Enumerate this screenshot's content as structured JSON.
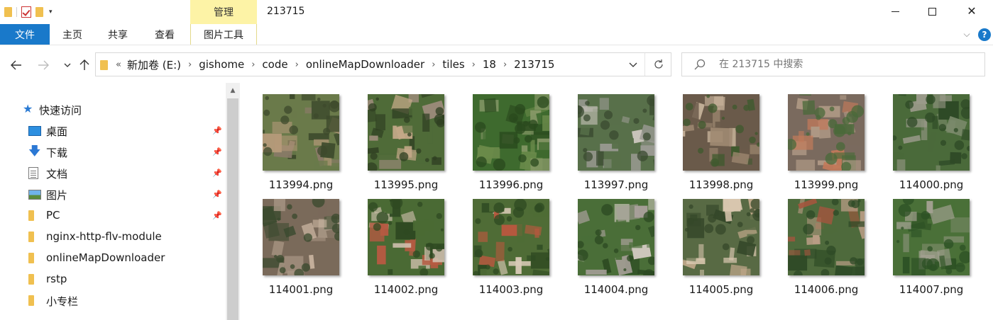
{
  "titlebar": {
    "manage_tab": "管理",
    "window_title": "213715",
    "minimize": "—",
    "maximize": "□",
    "close": "✕"
  },
  "ribbon": {
    "tabs": [
      {
        "label": "文件"
      },
      {
        "label": "主页"
      },
      {
        "label": "共享"
      },
      {
        "label": "查看"
      },
      {
        "label": "图片工具"
      }
    ],
    "help": "?"
  },
  "address": {
    "overflow": "«",
    "crumbs": [
      "新加卷 (E:)",
      "gishome",
      "code",
      "onlineMapDownloader",
      "tiles",
      "18",
      "213715"
    ],
    "separator": "›"
  },
  "search": {
    "placeholder": "在 213715 中搜索"
  },
  "nav": {
    "quick_access": "快速访问",
    "items": [
      {
        "label": "桌面",
        "icon": "desktop-icon",
        "pinned": true
      },
      {
        "label": "下载",
        "icon": "download-icon",
        "pinned": true
      },
      {
        "label": "文档",
        "icon": "document-icon",
        "pinned": true
      },
      {
        "label": "图片",
        "icon": "pictures-icon",
        "pinned": true
      },
      {
        "label": "PC",
        "icon": "folder-icon",
        "pinned": true
      },
      {
        "label": "nginx-http-flv-module",
        "icon": "folder-icon",
        "pinned": false
      },
      {
        "label": "onlineMapDownloader",
        "icon": "folder-icon",
        "pinned": false
      },
      {
        "label": "rstp",
        "icon": "folder-icon",
        "pinned": false
      },
      {
        "label": "小专栏",
        "icon": "folder-icon",
        "pinned": false
      }
    ]
  },
  "files": [
    {
      "name": "113994.png",
      "palette": [
        "#6a7a4a",
        "#3d4a2c",
        "#8a7a68",
        "#b59a7a"
      ]
    },
    {
      "name": "113995.png",
      "palette": [
        "#4f6b38",
        "#2f3f22",
        "#9a8a78",
        "#c4a888"
      ]
    },
    {
      "name": "113996.png",
      "palette": [
        "#3e6a2e",
        "#2a4a1e",
        "#6a8a4a",
        "#8a9a6a"
      ]
    },
    {
      "name": "113997.png",
      "palette": [
        "#58704a",
        "#3a4a30",
        "#9a9a92",
        "#c8c4ba"
      ]
    },
    {
      "name": "113998.png",
      "palette": [
        "#6a5a4a",
        "#3f5a2e",
        "#a08a72",
        "#c6b29a"
      ]
    },
    {
      "name": "113999.png",
      "palette": [
        "#7a6a5e",
        "#4a6a3a",
        "#b09a86",
        "#c27a5a"
      ]
    },
    {
      "name": "114000.png",
      "palette": [
        "#4a6a3a",
        "#2e4a26",
        "#7a8a6a",
        "#9a9a8a"
      ]
    },
    {
      "name": "114001.png",
      "palette": [
        "#7a6a5a",
        "#3a4a2e",
        "#a89684",
        "#c9b4a0"
      ]
    },
    {
      "name": "114002.png",
      "palette": [
        "#4a6a34",
        "#2f4a22",
        "#b65a42",
        "#d2c2b0"
      ]
    },
    {
      "name": "114003.png",
      "palette": [
        "#4f6c36",
        "#2e4a22",
        "#b8583e",
        "#d8cab6"
      ]
    },
    {
      "name": "114004.png",
      "palette": [
        "#4a6e38",
        "#2c4a22",
        "#a8a09a",
        "#cfc8be"
      ]
    },
    {
      "name": "114005.png",
      "palette": [
        "#586a44",
        "#35482a",
        "#c0a88a",
        "#d8c6ae"
      ]
    },
    {
      "name": "114006.png",
      "palette": [
        "#4e6a3c",
        "#2e4a26",
        "#b89c84",
        "#a5553e"
      ]
    },
    {
      "name": "114007.png",
      "palette": [
        "#4a7038",
        "#2c5024",
        "#7a8a68",
        "#a2a090"
      ]
    }
  ]
}
